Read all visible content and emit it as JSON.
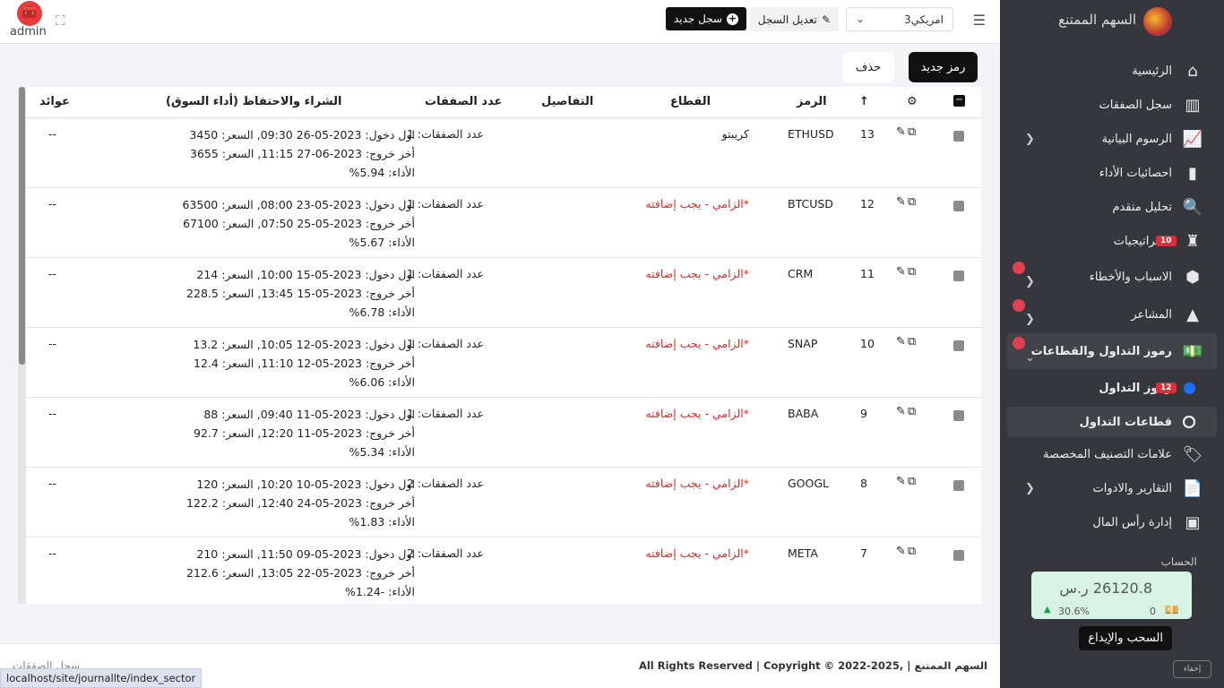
{
  "brand": {
    "title": "السهم الممتنع"
  },
  "sidebar": {
    "items": [
      {
        "label": "الرئيسية",
        "icon": "home-icon"
      },
      {
        "label": "سجل الصفقات",
        "icon": "journal-icon"
      },
      {
        "label": "الرسوم البيانية",
        "icon": "chart-line-icon"
      },
      {
        "label": "احصائيات الأداء",
        "icon": "bar-chart-icon"
      },
      {
        "label": "تحليل متقدم",
        "icon": "magnifier-chart-icon"
      },
      {
        "label": "استراتيجيات",
        "icon": "chess-icon",
        "badge": "10"
      },
      {
        "label": "الاسباب والأخطاء",
        "icon": "cubes-icon"
      },
      {
        "label": "المشاعر",
        "icon": "shapes-icon"
      },
      {
        "label": "رموز التداول والقطاعات",
        "icon": "dollar-card-icon"
      },
      {
        "label": "رموز التداول",
        "badge": "12"
      },
      {
        "label": "قطاعات التداول"
      },
      {
        "label": "علامات التصنيف المخصصة",
        "icon": "tags-icon"
      },
      {
        "label": "التقارير والادوات",
        "icon": "document-icon"
      },
      {
        "label": "إدارة رأس المال",
        "icon": "wallet-icon"
      }
    ],
    "account_label": "الحساب",
    "balance": {
      "amount": "26120.8 ر.س",
      "pct": "30.6%",
      "zero": "0"
    },
    "tooltip": "السحب والإيداع",
    "hide_label": "إخفاء"
  },
  "topbar": {
    "account_value": "امريكي3",
    "edit_label": "تعديل السجل",
    "new_label": "سجل جديد",
    "admin_name": "admin"
  },
  "toolbar": {
    "new_symbol": "رمز جديد",
    "delete": "حذف"
  },
  "table": {
    "headers": {
      "num": "",
      "symbol": "الرمز",
      "sector": "القطاع",
      "details": "التفاصيل",
      "trades": "عدد الصفقات",
      "buyhold": "الشراء والاحتفاظ (أداء السوق)",
      "returns": "عوائد"
    },
    "rows": [
      {
        "num": "13",
        "symbol": "ETHUSD",
        "sector": "كريبتو",
        "sector_required": false,
        "trades": "عدد الصفقات: 1",
        "entry": "اول دخول: 2023-05-26 09:30, السعر: 3450",
        "exit": "أخر خروج: 2023-06-27 11:15, السعر: 3655",
        "perf": "الأداء: 5.94%",
        "returns": "--"
      },
      {
        "num": "12",
        "symbol": "BTCUSD",
        "sector": "*الزامي - يجب إضافته",
        "sector_required": true,
        "trades": "عدد الصفقات: 1",
        "entry": "اول دخول: 2023-05-23 08:00, السعر: 63500",
        "exit": "أخر خروج: 2023-05-25 07:50, السعر: 67100",
        "perf": "الأداء: 5.67%",
        "returns": "--"
      },
      {
        "num": "11",
        "symbol": "CRM",
        "sector": "*الزامي - يجب إضافته",
        "sector_required": true,
        "trades": "عدد الصفقات: 1",
        "entry": "اول دخول: 2023-05-15 10:00, السعر: 214",
        "exit": "أخر خروج: 2023-05-15 13:45, السعر: 228.5",
        "perf": "الأداء: 6.78%",
        "returns": "--"
      },
      {
        "num": "10",
        "symbol": "SNAP",
        "sector": "*الزامي - يجب إضافته",
        "sector_required": true,
        "trades": "عدد الصفقات: 1",
        "entry": "اول دخول: 2023-05-12 10:05, السعر: 13.2",
        "exit": "أخر خروج: 2023-05-12 11:10, السعر: 12.4",
        "perf": "الأداء: 6.06%",
        "returns": "--"
      },
      {
        "num": "9",
        "symbol": "BABA",
        "sector": "*الزامي - يجب إضافته",
        "sector_required": true,
        "trades": "عدد الصفقات: 1",
        "entry": "اول دخول: 2023-05-11 09:40, السعر: 88",
        "exit": "أخر خروج: 2023-05-11 12:20, السعر: 92.7",
        "perf": "الأداء: 5.34%",
        "returns": "--"
      },
      {
        "num": "8",
        "symbol": "GOOGL",
        "sector": "*الزامي - يجب إضافته",
        "sector_required": true,
        "trades": "عدد الصفقات: 2",
        "entry": "اول دخول: 2023-05-10 10:20, السعر: 120",
        "exit": "أخر خروج: 2023-05-24 12:40, السعر: 122.2",
        "perf": "الأداء: 1.83%",
        "returns": "--"
      },
      {
        "num": "7",
        "symbol": "META",
        "sector": "*الزامي - يجب إضافته",
        "sector_required": true,
        "trades": "عدد الصفقات: 2",
        "entry": "اول دخول: 2023-05-09 11:50, السعر: 210",
        "exit": "أخر خروج: 2023-05-22 13:05, السعر: 212.6",
        "perf": "الأداء: -1.24%",
        "returns": "--"
      }
    ]
  },
  "footer": {
    "copyright": "All Rights Reserved | Copyright © 2022-2025, | السهم الممتنع",
    "breadcrumb": "سجل الصفقات"
  },
  "statusbar": {
    "url": "localhost/site/journallte/index_sector"
  },
  "colors": {
    "sidebar_bg": "#35373d",
    "badge": "#d9303d",
    "required": "#d03030",
    "balance_bg": "#d7f3e3"
  }
}
